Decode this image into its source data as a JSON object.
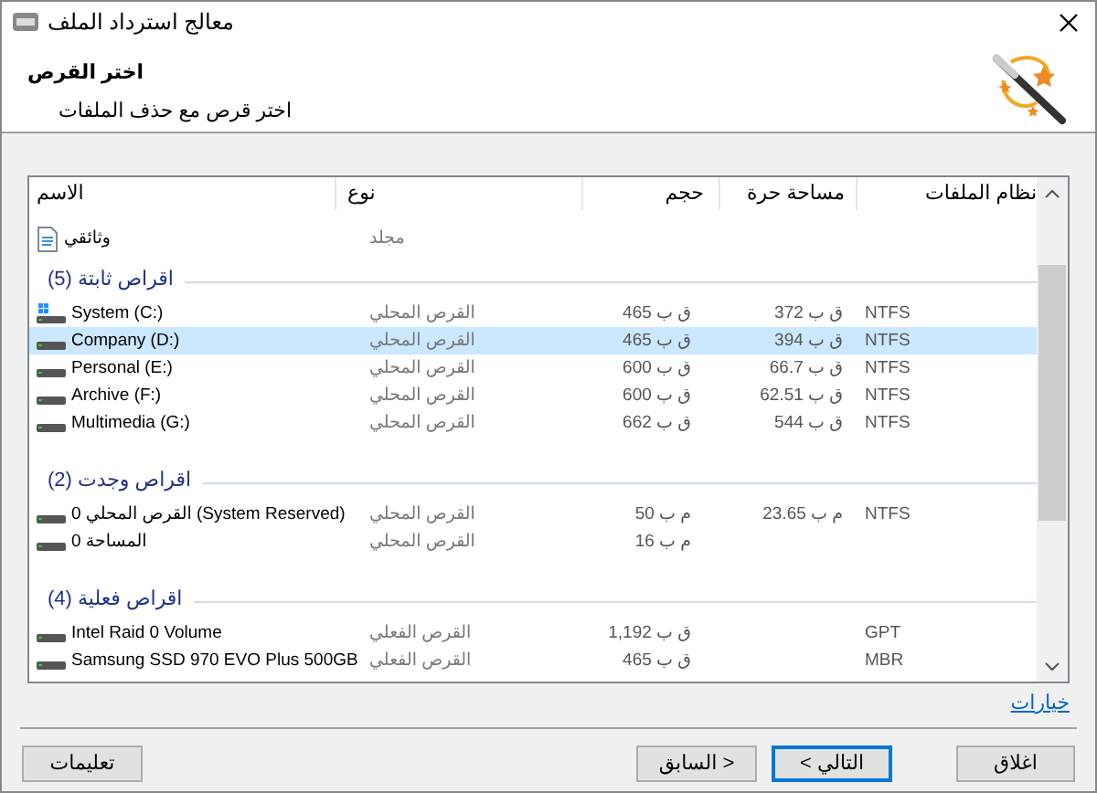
{
  "window": {
    "title": "معالج استرداد الملف"
  },
  "header": {
    "title": "اختر القرص",
    "subtitle": "اختر قرص مع حذف الملفات"
  },
  "table": {
    "column_headers": {
      "name": "الاسم",
      "type": "نوع",
      "size": "حجم",
      "free_space": "مساحة حرة",
      "file_system": "نظام الملفات"
    },
    "top_rows": [
      {
        "name": "وثائقي",
        "type": "مجلد",
        "kind": "document",
        "selected": false
      }
    ],
    "groups": [
      {
        "label": "(5) اقراص ثابتة",
        "rows": [
          {
            "name": "System (C:)",
            "type": "القرص المحلي",
            "size": "465 ق ب",
            "free": "372 ق ب",
            "fs": "NTFS",
            "kind": "system-drive",
            "selected": false
          },
          {
            "name": "Company (D:)",
            "type": "القرص المحلي",
            "size": "465 ق ب",
            "free": "394 ق ب",
            "fs": "NTFS",
            "kind": "drive",
            "selected": true
          },
          {
            "name": "Personal (E:)",
            "type": "القرص المحلي",
            "size": "600 ق ب",
            "free": "66.7 ق ب",
            "fs": "NTFS",
            "kind": "drive",
            "selected": false
          },
          {
            "name": "Archive (F:)",
            "type": "القرص المحلي",
            "size": "600 ق ب",
            "free": "62.51 ق ب",
            "fs": "NTFS",
            "kind": "drive",
            "selected": false
          },
          {
            "name": "Multimedia (G:)",
            "type": "القرص المحلي",
            "size": "662 ق ب",
            "free": "544 ق ب",
            "fs": "NTFS",
            "kind": "drive",
            "selected": false
          }
        ]
      },
      {
        "label": "(2) اقراص وجدت",
        "rows": [
          {
            "name": "القرص المحلي 0 (System Reserved)",
            "type": "القرص المحلي",
            "size": "50 م ب",
            "free": "23.65 م ب",
            "fs": "NTFS",
            "kind": "drive",
            "selected": false
          },
          {
            "name": "المساحة 0",
            "type": "القرص المحلي",
            "size": "16 م ب",
            "kind": "drive",
            "selected": false
          }
        ]
      },
      {
        "label": "(4) اقراص فعلية",
        "rows": [
          {
            "name": "Intel Raid 0 Volume",
            "type": "القرص الفعلي",
            "size": "1,192 ق ب",
            "fs": "GPT",
            "kind": "drive",
            "selected": false
          },
          {
            "name": "Samsung SSD 970 EVO Plus 500GB",
            "type": "القرص الفعلي",
            "size": "465 ق ب",
            "fs": "MBR",
            "kind": "drive",
            "selected": false
          }
        ]
      }
    ]
  },
  "options_link": "خيارات",
  "buttons": {
    "help": "تعليمات",
    "back": "السابق >",
    "next": "< التالي",
    "close": "اغلاق"
  }
}
